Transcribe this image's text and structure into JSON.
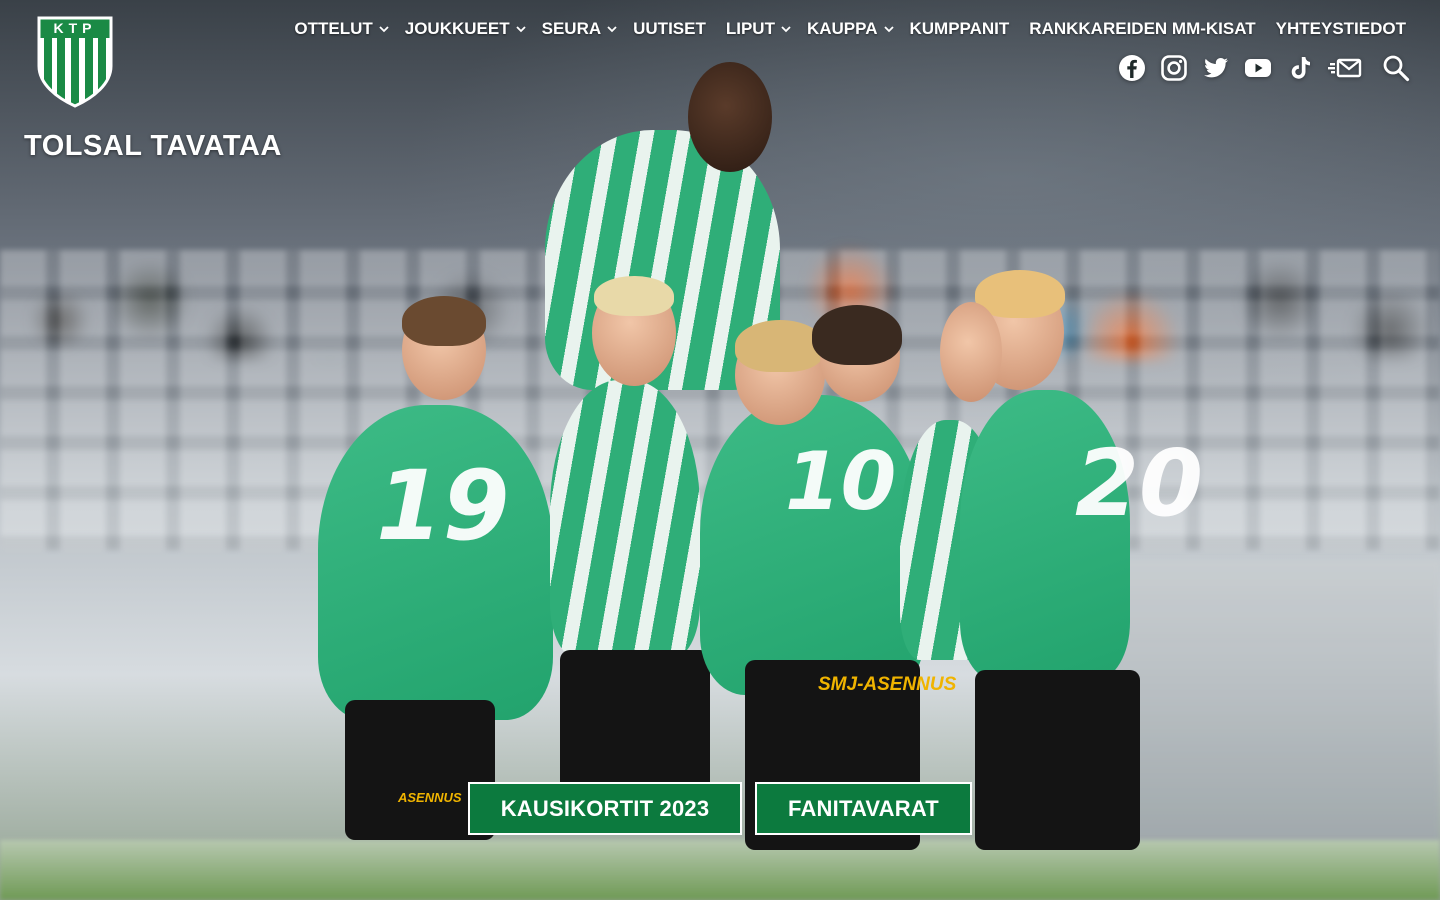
{
  "brand": {
    "logo_letters": "KTP",
    "tagline": "TOLSAL TAVATAA",
    "colors": {
      "green": "#0c7a3e",
      "stripe_green": "#1a8a45",
      "white": "#ffffff"
    }
  },
  "nav": {
    "items": [
      {
        "label": "OTTELUT",
        "has_dropdown": true
      },
      {
        "label": "JOUKKUEET",
        "has_dropdown": true
      },
      {
        "label": "SEURA",
        "has_dropdown": true
      },
      {
        "label": "UUTISET",
        "has_dropdown": false
      },
      {
        "label": "LIPUT",
        "has_dropdown": true
      },
      {
        "label": "KAUPPA",
        "has_dropdown": true
      },
      {
        "label": "KUMPPANIT",
        "has_dropdown": false
      },
      {
        "label": "RANKKAREIDEN MM-KISAT",
        "has_dropdown": false
      },
      {
        "label": "YHTEYSTIEDOT",
        "has_dropdown": false
      }
    ]
  },
  "social_icons": [
    "facebook-icon",
    "instagram-icon",
    "twitter-icon",
    "youtube-icon",
    "tiktok-icon",
    "newsletter-icon",
    "search-icon"
  ],
  "hero": {
    "jersey_numbers": [
      "19",
      "20",
      "10"
    ],
    "sponsor_texts": [
      "SMJ-ASENNUS",
      "ASENNUS"
    ],
    "cta_buttons": [
      {
        "label": "KAUSIKORTIT 2023"
      },
      {
        "label": "FANITAVARAT"
      }
    ]
  }
}
